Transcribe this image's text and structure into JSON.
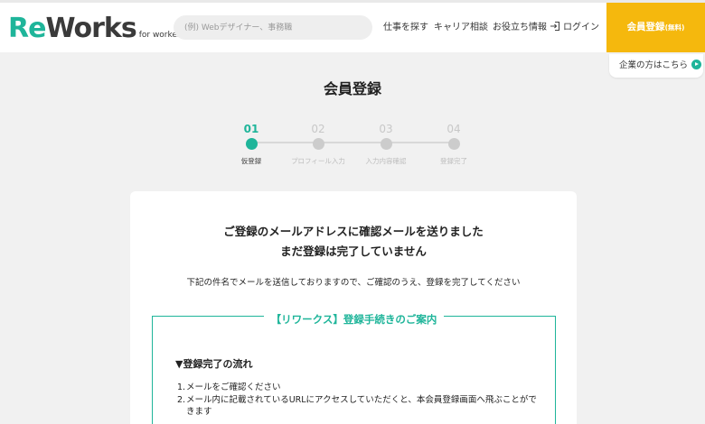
{
  "header": {
    "logo": {
      "re": "Re",
      "w": "W",
      "orks": "orks",
      "sub": "for worker"
    },
    "search": {
      "value": "",
      "placeholder": "(例) Webデザイナー、事務職"
    },
    "nav": {
      "find_jobs": "仕事を探す",
      "career": "キャリア相談",
      "info": "お役立ち情報",
      "login": "ログイン"
    },
    "register_button": {
      "label": "会員登録",
      "small": "(無料)"
    },
    "company_link": "企業の方はこちら"
  },
  "page_title": "会員登録",
  "steps": [
    {
      "num": "01",
      "label": "仮登録",
      "active": true
    },
    {
      "num": "02",
      "label": "プロフィール入力",
      "active": false
    },
    {
      "num": "03",
      "label": "入力内容確認",
      "active": false
    },
    {
      "num": "04",
      "label": "登録完了",
      "active": false
    }
  ],
  "card": {
    "message_line1": "ご登録のメールアドレスに確認メールを送りました",
    "message_line2": "まだ登録は完了していません",
    "sub_message": "下記の件名でメールを送信しておりますので、ご確認のうえ、登録を完了してください",
    "guide": {
      "title": "【リワークス】登録手続きのご案内",
      "flow_heading": "▼登録完了の流れ",
      "items": [
        {
          "n": "1.",
          "text": "メールをご確認ください"
        },
        {
          "n": "2.",
          "text": "メール内に記載されているURLにアクセスしていただくと、本会員登録画面へ飛ぶことができます"
        }
      ]
    }
  },
  "colors": {
    "brand_green": "#1fb59a",
    "cta_yellow": "#f5b80d",
    "background": "#f1f1f1"
  }
}
